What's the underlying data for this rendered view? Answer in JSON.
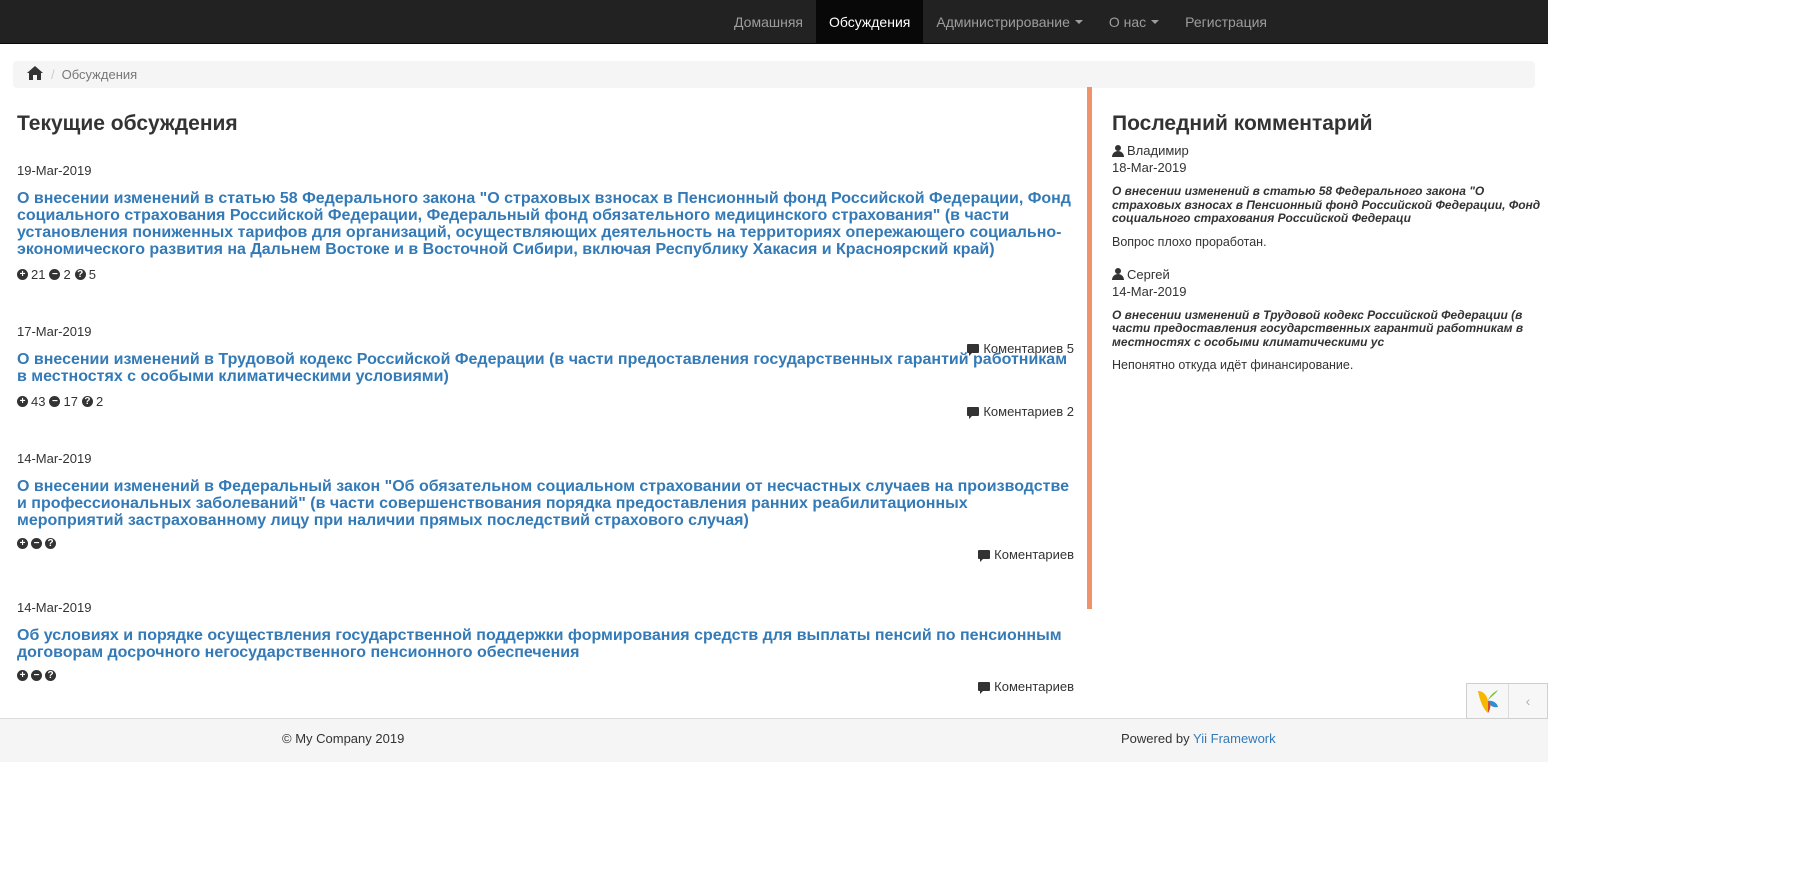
{
  "navbar": {
    "items": [
      {
        "label": "Домашняя"
      },
      {
        "label": "Обсуждения"
      },
      {
        "label": "Администрирование"
      },
      {
        "label": "О нас"
      },
      {
        "label": "Регистрация"
      }
    ]
  },
  "breadcrumb": {
    "current": "Обсуждения"
  },
  "main": {
    "heading": "Текущие обсуждения",
    "discussions": [
      {
        "date": "19-Mar-2019",
        "title": "О внесении изменений в статью 58 Федерального закона \"О страховых взносах в Пенсионный фонд Российской Федерации, Фонд социального страхования Российской Федерации, Федеральный фонд обязательного медицинского страхования\" (в части установления пониженных тарифов для организаций, осуществляющих деятельность на территориях опережающего социально-экономического развития на Дальнем Востоке и в Восточной Сибири, включая Республику Хакасия и Красноярский край)",
        "votes_up": "21",
        "votes_down": "2",
        "votes_question": "5",
        "comments": "Коментариев 5"
      },
      {
        "date": "17-Mar-2019",
        "title": "О внесении изменений в Трудовой кодекс Российской Федерации (в части предоставления государственных гарантий работникам в местностях с особыми климатическими условиями)",
        "votes_up": "43",
        "votes_down": "17",
        "votes_question": "2",
        "comments": "Коментариев 2"
      },
      {
        "date": "14-Mar-2019",
        "title": "О внесении изменений в Федеральный закон \"Об обязательном социальном страховании от несчастных случаев на производстве и профессиональных заболеваний\" (в части совершенствования порядка предоставления ранних реабилитационных мероприятий застрахованному лицу при наличии прямых последствий страхового случая)",
        "votes_up": "",
        "votes_down": "",
        "votes_question": "",
        "comments": "Коментариев"
      },
      {
        "date": "14-Mar-2019",
        "title": "Об условиях и порядке осуществления государственной поддержки формирования средств для выплаты пенсий по пенсионным договорам досрочного негосударственного пенсионного обеспечения",
        "votes_up": "",
        "votes_down": "",
        "votes_question": "",
        "comments": "Коментариев"
      }
    ]
  },
  "sidebar": {
    "heading": "Последний комментарий",
    "comments": [
      {
        "user": "Владимир",
        "date": "18-Mar-2019",
        "title": "О внесении изменений в статью 58 Федерального закона \"О страховых взносах в Пенсионный фонд Российской Федерации, Фонд социального страхования Российской Федераци",
        "text": "Вопрос плохо проработан."
      },
      {
        "user": "Сергей",
        "date": "14-Mar-2019",
        "title": "О внесении изменений в Трудовой кодекс Российской Федерации (в части предоставления государственных гарантий работникам в местностях с особыми климатическими ус",
        "text": "Непонятно откуда идёт финансирование."
      }
    ]
  },
  "footer": {
    "copyright": "© My Company 2019",
    "powered_prefix": "Powered by",
    "powered_link": "Yii Framework"
  },
  "debug_toolbar": {
    "toggle_glyph": "‹"
  },
  "colors": {
    "navbar_bg": "#222222",
    "link": "#337ab7",
    "accent_divider": "#f0926a"
  }
}
